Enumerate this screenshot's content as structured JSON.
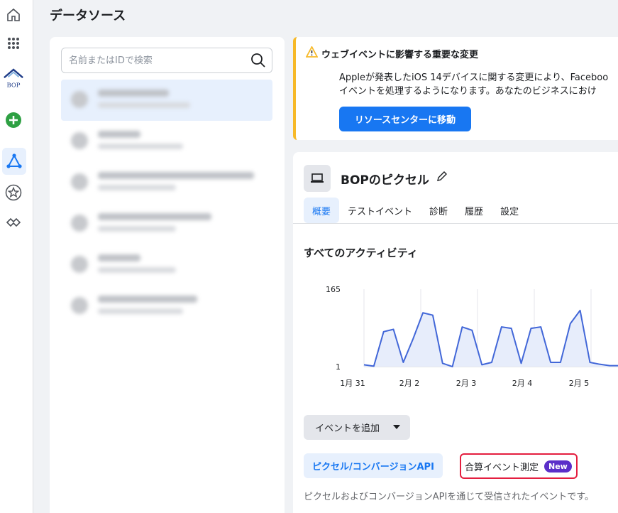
{
  "page": {
    "title": "データソース"
  },
  "rail": {
    "brand_text": "BOP"
  },
  "left_panel": {
    "search": {
      "placeholder": "名前またはIDで検索"
    }
  },
  "banner": {
    "title": "ウェブイベントに影響する重要な変更",
    "line1": "Appleが発表したiOS 14デバイスに関する変更により、Faceboo",
    "line2": "イベントを処理するようになります。あなたのビジネスにおけ",
    "button": "リソースセンターに移動",
    "accent_color": "#f7b928"
  },
  "pixel": {
    "name": "BOPのピクセル",
    "tabs": [
      "概要",
      "テストイベント",
      "診断",
      "履歴",
      "設定"
    ],
    "active_tab": 0
  },
  "activity": {
    "title": "すべてのアクティビティ"
  },
  "chart_data": {
    "type": "line",
    "x_tick_labels": [
      "1月 31",
      "2月 2",
      "2月 3",
      "2月 4",
      "2月 5"
    ],
    "y_tick_labels": [
      "165",
      "1"
    ],
    "ylim": [
      1,
      165
    ],
    "values": [
      5,
      2,
      75,
      80,
      10,
      60,
      115,
      110,
      8,
      1,
      85,
      78,
      5,
      10,
      85,
      82,
      8,
      82,
      85,
      10,
      10,
      92,
      120,
      10,
      6,
      3,
      3
    ],
    "grid": true,
    "color": "#4267d8"
  },
  "actions": {
    "add_event": "イベントを追加"
  },
  "subtabs": {
    "pixel_api": "ピクセル/コンバージョンAPI",
    "aem": "合算イベント測定",
    "new_badge": "New"
  },
  "footnote": "ピクセルおよびコンバージョンAPIを通じて受信されたイベントです。"
}
